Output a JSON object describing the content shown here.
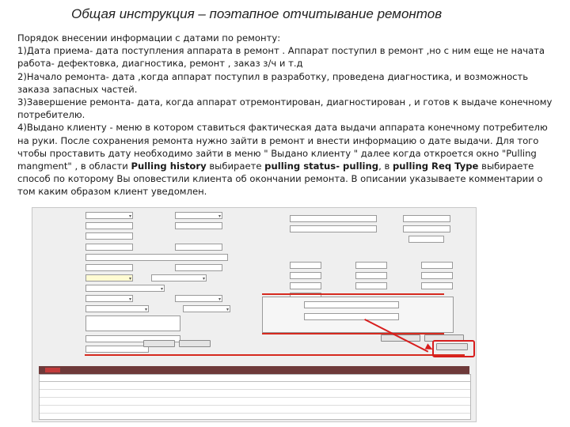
{
  "title": "Общая инструкция – поэтапное отчитывание ремонтов",
  "paragraphs": {
    "p0": "Порядок внесении информации с датами по ремонту:",
    "p1": "1)Дата приема- дата поступления аппарата в ремонт . Аппарат поступил в ремонт ,но с ним еще не начата работа- дефектовка, диагностика, ремонт , заказ з/ч и т.д",
    "p2": "2)Начало ремонта- дата ,когда аппарат поступил в разработку, проведена диагностика, и возможность заказа запасных частей.",
    "p3": "3)Завершение ремонта- дата, когда аппарат отремонтирован, диагностирован , и готов к выдаче конечному потребителю.",
    "p4_a": "4)Выдано клиенту - меню в котором ставиться фактическая дата выдачи аппарата конечному потребителю на руки. После сохранения ремонта нужно зайти в ремонт и внести информацию о дате выдачи. Для того чтобы проставить дату необходимо зайти в меню \" Выдано клиенту \" далее когда откроется окно \"Pulling mangment\" , в области ",
    "p4_b1": "Pulling history",
    "p4_c": " выбираете ",
    "p4_b2": "pulling status- pulling",
    "p4_d": ", в ",
    "p4_b3": "pulling Req Type",
    "p4_e": " выбираете способ по которому Вы оповестили клиента об окончании ремонта. В описании указываете комментарии о том каким образом клиент уведомлен."
  },
  "screenshot": {
    "accent": "#d81e1e",
    "tab_bar_color": "#6e3a3a"
  }
}
